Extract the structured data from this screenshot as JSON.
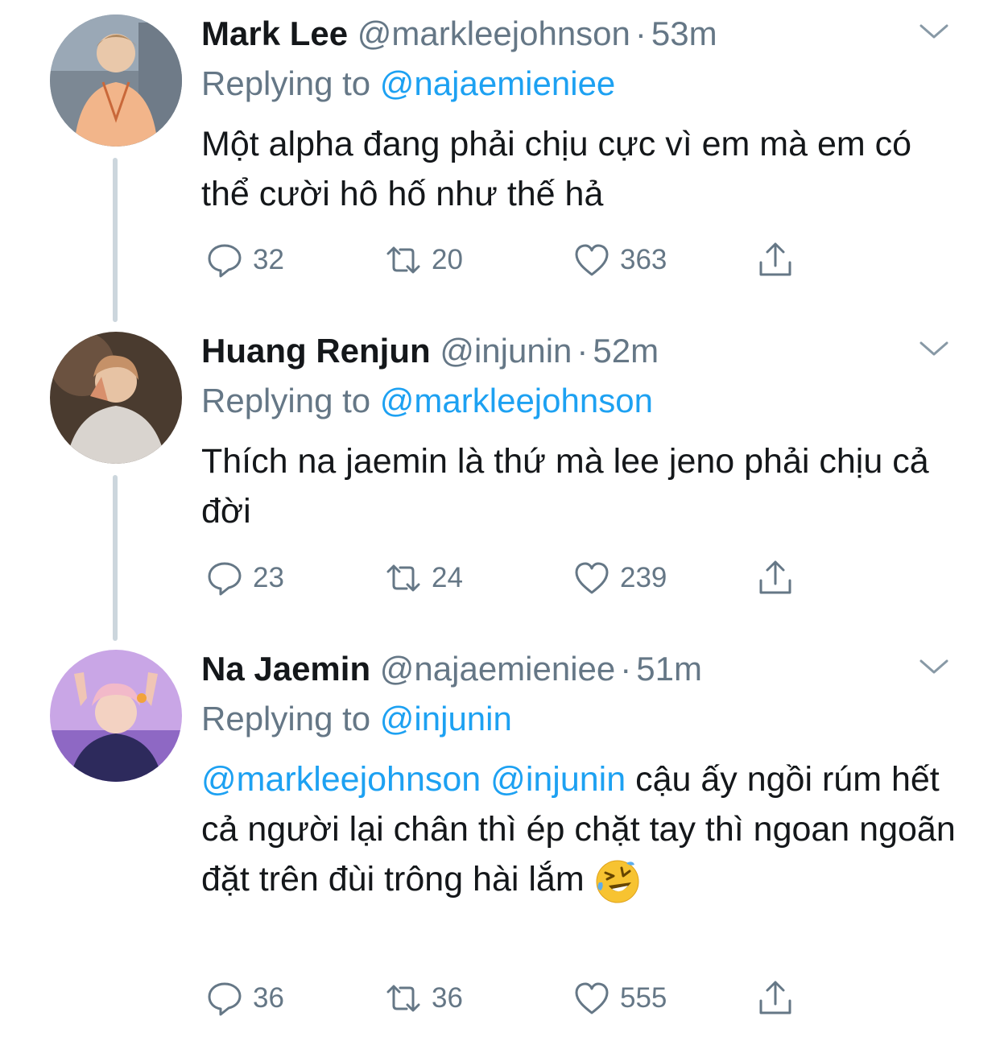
{
  "colors": {
    "link": "#1da1f2",
    "secondary_text": "#657786",
    "primary_text": "#14171a",
    "thread_line": "#ccd6dd"
  },
  "tweets": [
    {
      "name": "Mark Lee",
      "handle": "@markleejohnson",
      "separator": "·",
      "time": "53m",
      "replying_prefix": "Replying to ",
      "replying_to": "@najaemieniee",
      "text": "Một alpha đang phải chịu cực vì em mà em có thể cười hô hố như thế hả",
      "replies": "32",
      "retweets": "20",
      "likes": "363",
      "avatar_icon": "avatar-photo"
    },
    {
      "name": "Huang Renjun",
      "handle": "@injunin",
      "separator": "·",
      "time": "52m",
      "replying_prefix": "Replying to ",
      "replying_to": "@markleejohnson",
      "text": "Thích na jaemin là thứ mà lee jeno phải chịu cả đời",
      "replies": "23",
      "retweets": "24",
      "likes": "239",
      "avatar_icon": "avatar-photo"
    },
    {
      "name": "Na Jaemin",
      "handle": "@najaemieniee",
      "separator": "·",
      "time": "51m",
      "replying_prefix": "Replying to ",
      "replying_to": "@injunin",
      "mention_1": "@markleejohnson",
      "mention_2": "@injunin",
      "text": "cậu ấy ngồi rúm hết cả người lại chân thì ép chặt tay thì ngoan ngoãn đặt trên đùi trông hài lắm",
      "emoji_icon": "rolling-on-floor-laughing-emoji",
      "replies": "36",
      "retweets": "36",
      "likes": "555",
      "avatar_icon": "avatar-photo"
    }
  ],
  "icons": {
    "reply": "reply-icon",
    "retweet": "retweet-icon",
    "like": "heart-icon",
    "share": "share-icon",
    "menu": "chevron-down-icon"
  }
}
